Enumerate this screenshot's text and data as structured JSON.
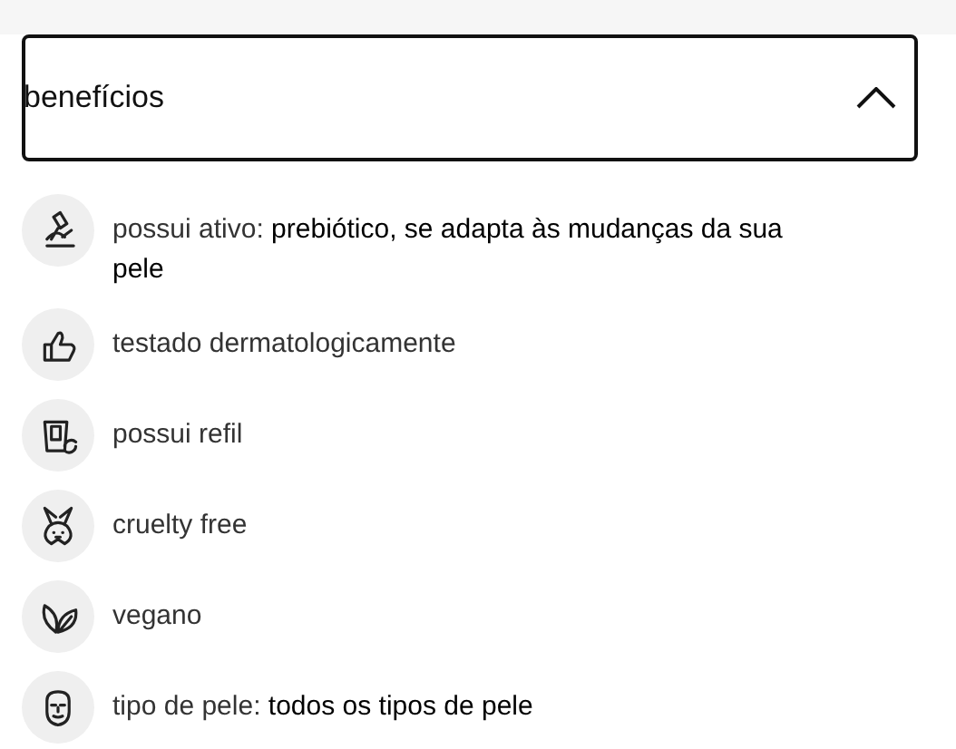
{
  "accordion": {
    "title": "benefícios",
    "expanded": true,
    "items": [
      {
        "kind": "microscope",
        "text": "possui ativo: **prebiótico, se adapta às mudanças da sua pele**"
      },
      {
        "kind": "thumb",
        "text": "testado dermatologicamente"
      },
      {
        "kind": "refill",
        "text": "possui refil"
      },
      {
        "kind": "rabbit",
        "text": "cruelty free"
      },
      {
        "kind": "leaf",
        "text": "vegano"
      },
      {
        "kind": "face",
        "text": "tipo de pele: **todos os tipos de pele**"
      }
    ]
  }
}
